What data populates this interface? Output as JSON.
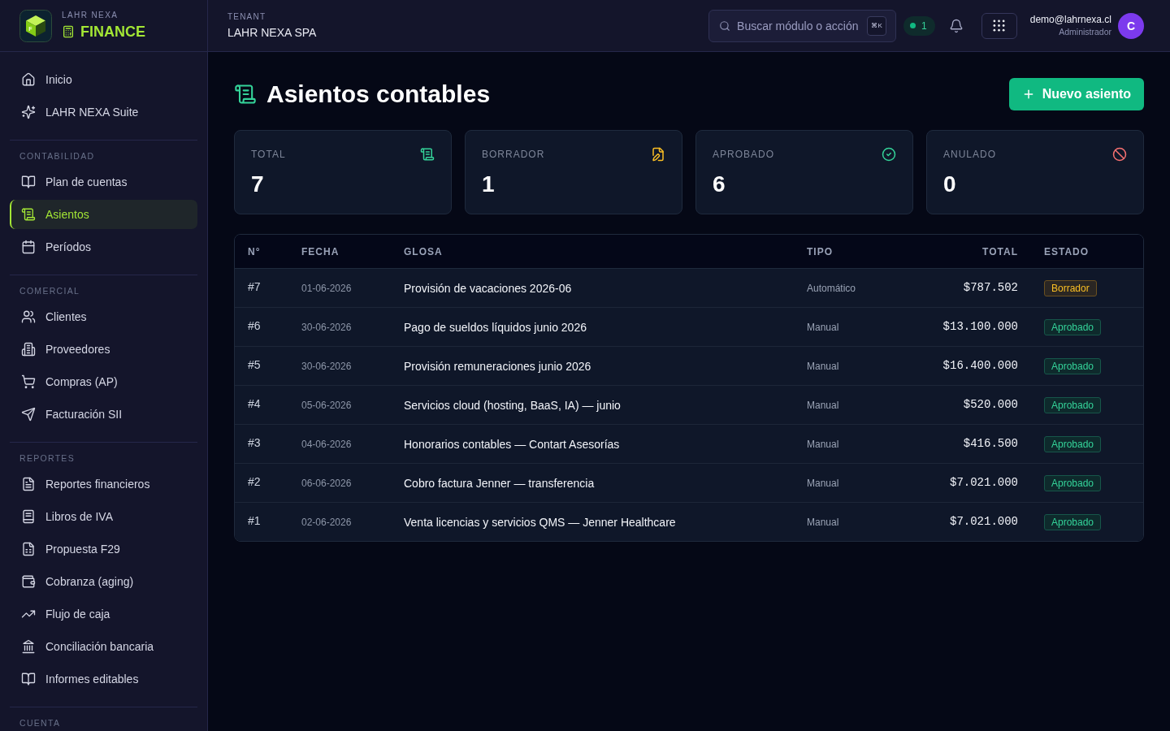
{
  "brand": {
    "overline": "LAHR NEXA",
    "name": "FINANCE",
    "logo_letter": "F"
  },
  "sidebar": {
    "items": [
      {
        "label": "Inicio",
        "selected": false
      },
      {
        "label": "LAHR NEXA Suite",
        "selected": false
      }
    ],
    "sections": [
      {
        "title": "CONTABILIDAD",
        "items": [
          {
            "label": "Plan de cuentas",
            "selected": false
          },
          {
            "label": "Asientos",
            "selected": true
          },
          {
            "label": "Períodos",
            "selected": false
          }
        ]
      },
      {
        "title": "COMERCIAL",
        "items": [
          {
            "label": "Clientes",
            "selected": false
          },
          {
            "label": "Proveedores",
            "selected": false
          },
          {
            "label": "Compras (AP)",
            "selected": false
          },
          {
            "label": "Facturación SII",
            "selected": false
          }
        ]
      },
      {
        "title": "REPORTES",
        "items": [
          {
            "label": "Reportes financieros",
            "selected": false
          },
          {
            "label": "Libros de IVA",
            "selected": false
          },
          {
            "label": "Propuesta F29",
            "selected": false
          },
          {
            "label": "Cobranza (aging)",
            "selected": false
          },
          {
            "label": "Flujo de caja",
            "selected": false
          },
          {
            "label": "Conciliación bancaria",
            "selected": false
          },
          {
            "label": "Informes editables",
            "selected": false
          }
        ]
      },
      {
        "title": "CUENTA"
      }
    ]
  },
  "topbar": {
    "tenant_label": "TENANT",
    "tenant_name": "LAHR NEXA SPA",
    "search": {
      "placeholder": "Buscar módulo o acción",
      "shortcut": "⌘K"
    },
    "online_count": "1",
    "user": {
      "email": "demo@lahrnexa.cl",
      "role": "Administrador",
      "initial": "C"
    }
  },
  "page": {
    "title": "Asientos contables",
    "new_button": "Nuevo asiento",
    "stats": [
      {
        "kind": "total",
        "label": "TOTAL",
        "value": "7",
        "color": "#34d399"
      },
      {
        "kind": "draft",
        "label": "BORRADOR",
        "value": "1",
        "color": "#fbbf24"
      },
      {
        "kind": "approved",
        "label": "APROBADO",
        "value": "6",
        "color": "#34d399"
      },
      {
        "kind": "void",
        "label": "ANULADO",
        "value": "0",
        "color": "#f87171"
      }
    ],
    "table": {
      "columns": [
        "N°",
        "FECHA",
        "GLOSA",
        "TIPO",
        "TOTAL",
        "ESTADO"
      ],
      "rows": [
        {
          "number": "#7",
          "date": "01-06-2026",
          "description": "Provisión de vacaciones 2026-06",
          "type": "Automático",
          "total": "$787.502",
          "status": {
            "label": "Borrador",
            "kind": "draft"
          }
        },
        {
          "number": "#6",
          "date": "30-06-2026",
          "description": "Pago de sueldos líquidos junio 2026",
          "type": "Manual",
          "total": "$13.100.000",
          "status": {
            "label": "Aprobado",
            "kind": "approved"
          }
        },
        {
          "number": "#5",
          "date": "30-06-2026",
          "description": "Provisión remuneraciones junio 2026",
          "type": "Manual",
          "total": "$16.400.000",
          "status": {
            "label": "Aprobado",
            "kind": "approved"
          }
        },
        {
          "number": "#4",
          "date": "05-06-2026",
          "description": "Servicios cloud (hosting, BaaS, IA) — junio",
          "type": "Manual",
          "total": "$520.000",
          "status": {
            "label": "Aprobado",
            "kind": "approved"
          }
        },
        {
          "number": "#3",
          "date": "04-06-2026",
          "description": "Honorarios contables — Contart Asesorías",
          "type": "Manual",
          "total": "$416.500",
          "status": {
            "label": "Aprobado",
            "kind": "approved"
          }
        },
        {
          "number": "#2",
          "date": "06-06-2026",
          "description": "Cobro factura Jenner — transferencia",
          "type": "Manual",
          "total": "$7.021.000",
          "status": {
            "label": "Aprobado",
            "kind": "approved"
          }
        },
        {
          "number": "#1",
          "date": "02-06-2026",
          "description": "Venta licencias y servicios QMS — Jenner Healthcare",
          "type": "Manual",
          "total": "$7.021.000",
          "status": {
            "label": "Aprobado",
            "kind": "approved"
          }
        }
      ]
    }
  }
}
